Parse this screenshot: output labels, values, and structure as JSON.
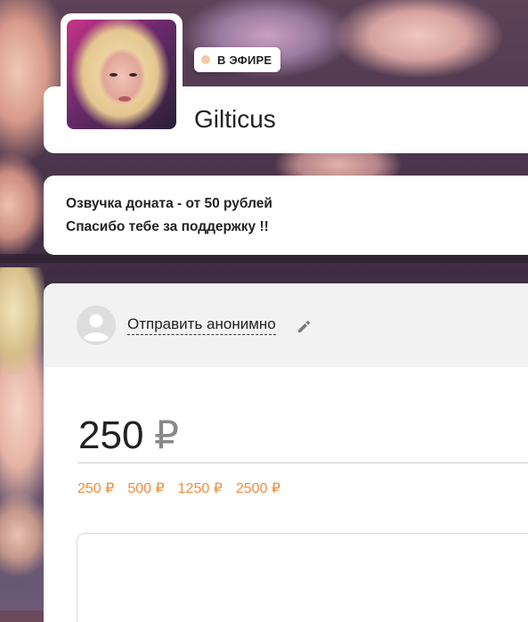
{
  "streamer": {
    "name": "Gilticus",
    "live_label": "В ЭФИРЕ"
  },
  "description": {
    "line1": "Озвучка доната - от 50 рублей",
    "line2": "Спасибо тебе за поддержку !!"
  },
  "sender": {
    "anonymous_label": "Отправить анонимно"
  },
  "amount": {
    "value": "250",
    "currency": "₽",
    "presets": [
      "250 ₽",
      "500 ₽",
      "1250 ₽",
      "2500 ₽"
    ]
  },
  "colors": {
    "accent": "#f08d3c",
    "live_dot": "#f2c9a5"
  },
  "icons": {
    "pencil": "pencil-icon",
    "user": "user-icon"
  }
}
